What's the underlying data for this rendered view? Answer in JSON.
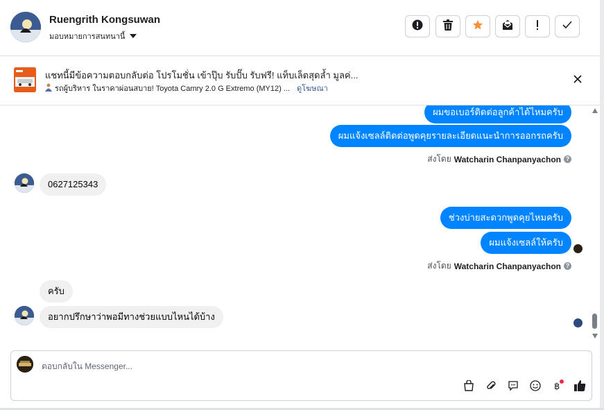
{
  "header": {
    "contact_name": "Ruengrith Kongsuwan",
    "assign_label": "มอบหมายการสนทนานี้",
    "toolbar": [
      {
        "name": "spam-icon",
        "glyph": "!"
      },
      {
        "name": "trash-icon"
      },
      {
        "name": "star-icon",
        "color": "#f7923b"
      },
      {
        "name": "mark-unread-icon"
      },
      {
        "name": "follow-up-icon",
        "glyph": "!"
      },
      {
        "name": "done-icon"
      }
    ]
  },
  "ad": {
    "title": "แชทนี้มีข้อความตอบกลับต่อ โปรโมชั่น เข้าปุ๊บ รับปั๊บ รับฟรี! แท็บเล็ตสุดล้ำ มูลค่...",
    "subtitle": "รถผู้บริหาร ในราคาผ่อนสบาย! Toyota Camry 2.0 G Extremo (MY12) ...",
    "link": "ดูโฆษณา"
  },
  "messages": [
    {
      "side": "out",
      "text": "ผมขอเบอร์ติดต่อลูกค้าได้ไหมครับ"
    },
    {
      "side": "out",
      "text": "ผมแจ้งเซลล์ติดต่อพูดคุยรายละเอียดแนะนำการออกรถครับ"
    },
    {
      "meta_prefix": "ส่งโดย",
      "meta_name": "Watcharin Chanpanyachon"
    },
    {
      "side": "in",
      "text": "0627125343"
    },
    {
      "side": "out",
      "text": "ช่วงบ่ายสะดวกพูดคุยไหมครับ"
    },
    {
      "side": "out",
      "text": "ผมแจ้งเซลล์ให้ครับ"
    },
    {
      "meta_prefix": "ส่งโดย",
      "meta_name": "Watcharin Chanpanyachon"
    },
    {
      "side": "in",
      "text": "ครับ"
    },
    {
      "side": "in",
      "text": "อยากปรึกษาว่าพอมีทางช่วยแบบไหนได้บ้าง"
    }
  ],
  "composer": {
    "placeholder": "ตอบกลับใน Messenger...",
    "icons": [
      "bag-icon",
      "paperclip-icon",
      "saved-reply-icon",
      "emoji-icon",
      "payment-icon",
      "like-icon"
    ],
    "accent": "#1877f2"
  },
  "colors": {
    "outgoing_bubble": "#0084ff",
    "incoming_bubble": "#f0f0f0"
  }
}
